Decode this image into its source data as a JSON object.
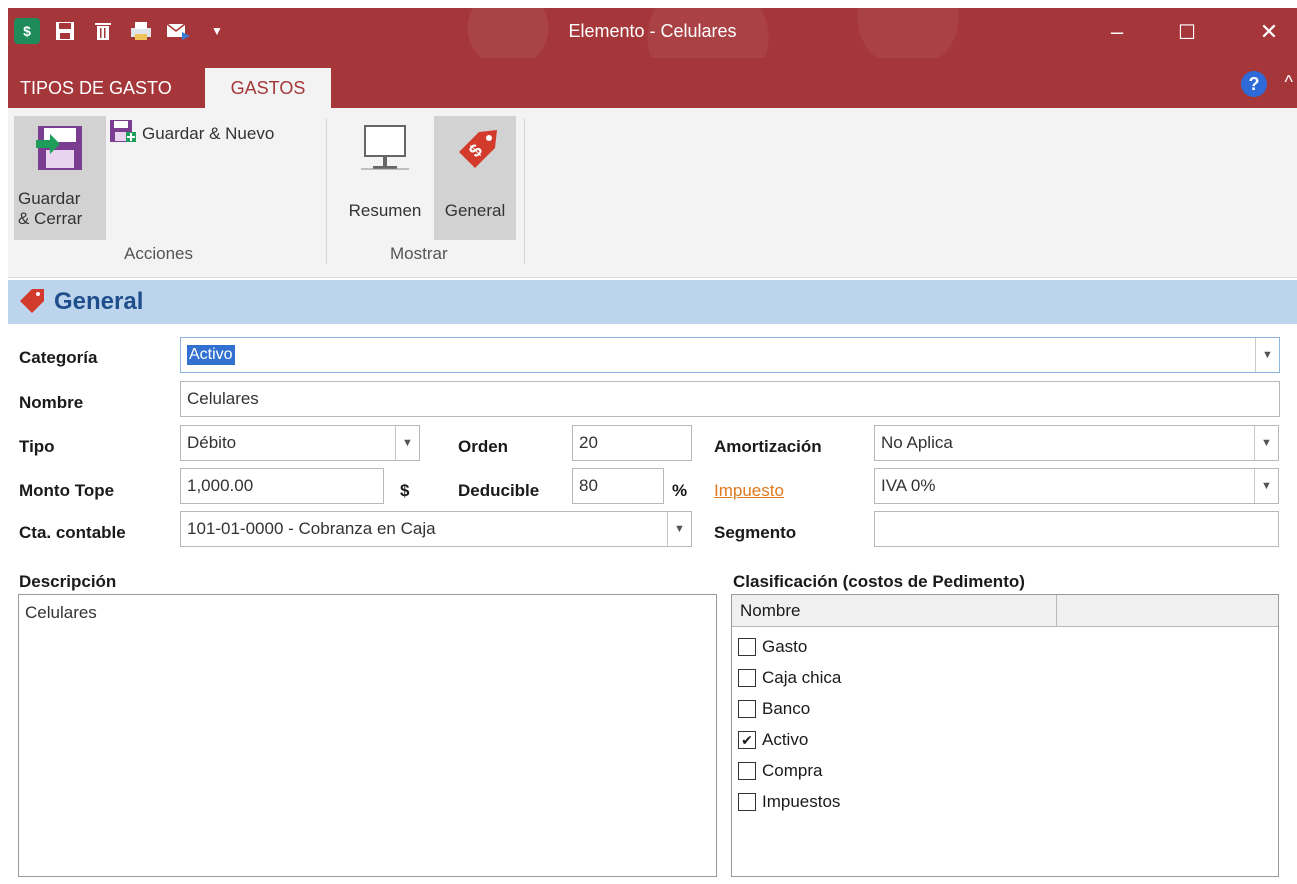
{
  "window": {
    "title": "Elemento - Celulares",
    "minimize_glyph": "–",
    "maximize_glyph": "☐",
    "close_glyph": "✕"
  },
  "tabs": [
    {
      "label": "TIPOS DE GASTO"
    },
    {
      "label": "GASTOS"
    }
  ],
  "ribbon": {
    "guardar_cerrar": "Guardar\n& Cerrar",
    "guardar_nuevo": "Guardar & Nuevo",
    "acciones_label": "Acciones",
    "resumen": "Resumen",
    "general": "General",
    "mostrar_label": "Mostrar"
  },
  "section": {
    "title": "General"
  },
  "form": {
    "categoria_label": "Categoría",
    "categoria_value": "Activo",
    "nombre_label": "Nombre",
    "nombre_value": "Celulares",
    "tipo_label": "Tipo",
    "tipo_value": "Débito",
    "orden_label": "Orden",
    "orden_value": "20",
    "amortizacion_label": "Amortización",
    "amortizacion_value": "No Aplica",
    "monto_label": "Monto Tope",
    "monto_value": "1,000.00",
    "monto_unit": "$",
    "deducible_label": "Deducible",
    "deducible_value": "80",
    "deducible_unit": "%",
    "impuesto_label": "Impuesto",
    "impuesto_value": "IVA 0%",
    "cta_label": "Cta. contable",
    "cta_value": "101-01-0000 - Cobranza en Caja",
    "segmento_label": "Segmento",
    "segmento_value": "",
    "descripcion_label": "Descripción",
    "descripcion_value": "Celulares",
    "clasificacion_label": "Clasificación (costos de Pedimento)"
  },
  "grid": {
    "column": "Nombre",
    "items": [
      {
        "label": "Gasto",
        "checked": false
      },
      {
        "label": "Caja chica",
        "checked": false
      },
      {
        "label": "Banco",
        "checked": false
      },
      {
        "label": "Activo",
        "checked": true
      },
      {
        "label": "Compra",
        "checked": false
      },
      {
        "label": "Impuestos",
        "checked": false
      }
    ]
  },
  "colors": {
    "titlebar": "#a5373b",
    "section_bg": "#bdd5ec",
    "section_text": "#1f4e8c",
    "link": "#e07a1f"
  }
}
